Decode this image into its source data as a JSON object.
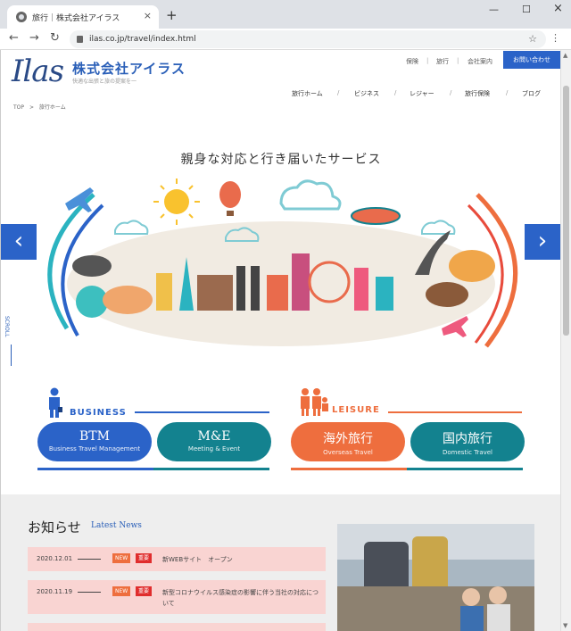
{
  "browser": {
    "tab_title": "旅行｜株式会社アイラス",
    "url": "ilas.co.jp/travel/index.html",
    "close": "×",
    "new_tab": "+",
    "min": "—",
    "max": "☐",
    "win_close": "×",
    "back": "←",
    "forward": "→",
    "reload": "↻",
    "star": "☆",
    "menu": "⋮"
  },
  "header": {
    "logo_text": "Ilas",
    "company": "株式会社アイラス",
    "tagline": "快適な出張と旅の提案を一",
    "top_nav": [
      "保険",
      "旅行",
      "会社案内"
    ],
    "top_sep": "|",
    "contact": "お問い合わせ",
    "global_nav": [
      "旅行ホーム",
      "ビジネス",
      "レジャー",
      "旅行保険",
      "ブログ"
    ],
    "nav_sep": "/"
  },
  "breadcrumb": {
    "top": "TOP",
    "sep": ">",
    "current": "旅行ホーム"
  },
  "hero": {
    "title": "親身な対応と行き届いたサービス",
    "prev": "‹",
    "next": "›",
    "scroll": "SCROLL"
  },
  "business": {
    "heading": "BUSINESS",
    "color": "#2b63c8",
    "items": [
      {
        "title": "BTM",
        "sub": "Business Travel Management",
        "color": "#2b63c8"
      },
      {
        "title": "M&E",
        "sub": "Meeting & Event",
        "color": "#13828f"
      }
    ]
  },
  "leisure": {
    "heading": "LEISURE",
    "color": "#ee6e3e",
    "items": [
      {
        "title": "海外旅行",
        "sub": "Overseas Travel",
        "color": "#ee6e3e"
      },
      {
        "title": "国内旅行",
        "sub": "Domestic Travel",
        "color": "#13828f"
      }
    ]
  },
  "news": {
    "title": "お知らせ",
    "subtitle": "Latest News",
    "badge_new": "NEW",
    "badge_important": "重要",
    "items": [
      {
        "date": "2020.12.01",
        "text": "新WEBサイト　オープン"
      },
      {
        "date": "2020.11.19",
        "text": "新型コロナウイルス感染症の影響に伴う当社の対応について"
      }
    ]
  }
}
